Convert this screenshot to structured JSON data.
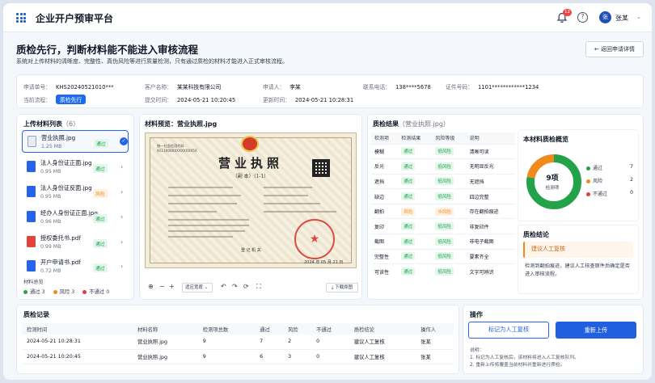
{
  "app": {
    "title": "企业开户预审平台",
    "notification_count": "12",
    "avatar_text": "张",
    "user_name": "张某"
  },
  "page": {
    "title": "质检先行，判断材料能不能进入审核流程",
    "subtitle": "系统对上传材料的清晰度、完整性、真伪风险等进行质量检测，只有通过质检的材料才能进入正式审核流程。",
    "back_label": "返回申请详情"
  },
  "info": {
    "apply_no_label": "申请单号：",
    "apply_no": "KHS20240521010***",
    "customer_label": "客户名称：",
    "customer": "某某科技有限公司",
    "applicant_label": "申请人：",
    "applicant": "李某",
    "phone_label": "联系电话：",
    "phone": "138****5678",
    "id_label": "证件号码：",
    "id": "1101************1234",
    "stage_label": "当前流程：",
    "stage": "质检先行",
    "submit_label": "提交时间：",
    "submit_time": "2024-05-21 10:20:45",
    "update_label": "更新时间：",
    "update_time": "2024-05-21 10:28:31"
  },
  "files": {
    "title": "上传材料列表",
    "count": "（6）",
    "items": [
      {
        "name": "营业执照.jpg",
        "size": "1.25 MB",
        "status": "通过",
        "icon": "image-file-icon"
      },
      {
        "name": "法人身份证正面.jpg",
        "size": "0.95 MB",
        "status": "通过",
        "icon": "id-card-file-icon"
      },
      {
        "name": "法人身份证反面.jpg",
        "size": "0.95 MB",
        "status": "风险",
        "icon": "id-card-file-icon"
      },
      {
        "name": "经办人身份证正面.jpg",
        "size": "0.96 MB",
        "status": "通过",
        "icon": "id-card-file-icon"
      },
      {
        "name": "授权委托书.pdf",
        "size": "0.99 MB",
        "status": "通过",
        "icon": "pdf-file-icon"
      },
      {
        "name": "开户申请书.pdf",
        "size": "0.72 MB",
        "status": "通过",
        "icon": "doc-file-icon"
      }
    ],
    "legend_title": "材料总览",
    "legend": [
      {
        "label": "通过",
        "count": "3"
      },
      {
        "label": "风险",
        "count": "3"
      },
      {
        "label": "不通过",
        "count": "0"
      }
    ]
  },
  "preview": {
    "title": "材料预览：营业执照.jpg",
    "cert": {
      "code_label": "统一社会信用代码",
      "code": "91110000XXXXXXXX5X",
      "title": "营业执照",
      "sub": "（副 本）（1-1）",
      "reg": "登 记 机 关",
      "date": "2024 年 05 月 21 日"
    },
    "zoom": "适应宽度",
    "url": "http://www.gsxt.gov.cn",
    "download": "下载原图"
  },
  "results": {
    "title": "质检结果",
    "file": "（营业执照.jpg）",
    "headers": [
      "检测项",
      "检测结果",
      "风险等级",
      "说明"
    ],
    "rows": [
      [
        "模糊",
        "通过",
        "低风险",
        "清晰可读"
      ],
      [
        "反光",
        "通过",
        "低风险",
        "无明显反光"
      ],
      [
        "遮挡",
        "通过",
        "低风险",
        "无遮挡"
      ],
      [
        "缺边",
        "通过",
        "低风险",
        "四边完整"
      ],
      [
        "翻拍",
        "风险",
        "中风险",
        "存在翻拍痕迹"
      ],
      [
        "复印",
        "通过",
        "低风险",
        "非复印件"
      ],
      [
        "截图",
        "通过",
        "低风险",
        "非电子截图"
      ],
      [
        "完整性",
        "通过",
        "低风险",
        "要素齐全"
      ],
      [
        "可读性",
        "通过",
        "低风险",
        "文字可辨识"
      ]
    ]
  },
  "overview": {
    "title": "本材料质检概览",
    "total": "9项",
    "total_label": "检测项",
    "items": [
      {
        "label": "通过",
        "value": 7
      },
      {
        "label": "风险",
        "value": 2
      },
      {
        "label": "不通过",
        "value": 0
      }
    ],
    "colors": {
      "pass": "#22a34a",
      "risk": "#f08a1a",
      "fail": "#e23c3c"
    }
  },
  "conclusion": {
    "title": "质检结论",
    "advice": "建议人工复核",
    "text": "检测到翻拍痕迹，建议人工核查原件后确定是否进入审核流程。"
  },
  "records": {
    "title": "质检记录",
    "headers": [
      "检测时间",
      "材料名称",
      "检测项总数",
      "通过",
      "风险",
      "不通过",
      "质检结论",
      "操作人"
    ],
    "rows": [
      [
        "2024-05-21 10:28:31",
        "营业执照.jpg",
        "9",
        "7",
        "2",
        "0",
        "建议人工复核",
        "张某"
      ],
      [
        "2024-05-21 10:20:45",
        "营业执照.jpg",
        "9",
        "6",
        "3",
        "0",
        "建议人工复核",
        "张某"
      ]
    ]
  },
  "actions": {
    "title": "操作",
    "mark_review": "标记为人工复核",
    "reupload": "重新上传",
    "note_title": "说明：",
    "notes": [
      "1. 标记为人工复核后，该材料将进入人工复核队列。",
      "2. 重新上传将覆盖当前材料并重新进行质检。"
    ]
  }
}
